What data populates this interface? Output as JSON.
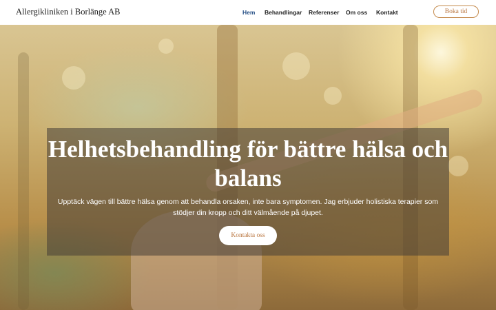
{
  "header": {
    "brand": "Allergikliniken i Borlänge AB",
    "nav": [
      {
        "label": "Hem",
        "active": true
      },
      {
        "label": "Behandlingar",
        "active": false
      },
      {
        "label": "Referenser",
        "active": false
      },
      {
        "label": "Om oss",
        "active": false
      },
      {
        "label": "Kontakt",
        "active": false
      }
    ],
    "cta_label": "Boka tid"
  },
  "hero": {
    "title": "Helhetsbehandling för bättre hälsa och balans",
    "description": "Upptäck vägen till bättre hälsa genom att behandla orsaken, inte bara symptomen. Jag erbjuder holistiska terapier som stödjer din kropp och ditt välmående på djupet.",
    "button_label": "Kontakta oss"
  },
  "colors": {
    "accent": "#c4894a",
    "nav_active": "#254f86",
    "overlay": "rgba(70,62,55,0.55)"
  }
}
